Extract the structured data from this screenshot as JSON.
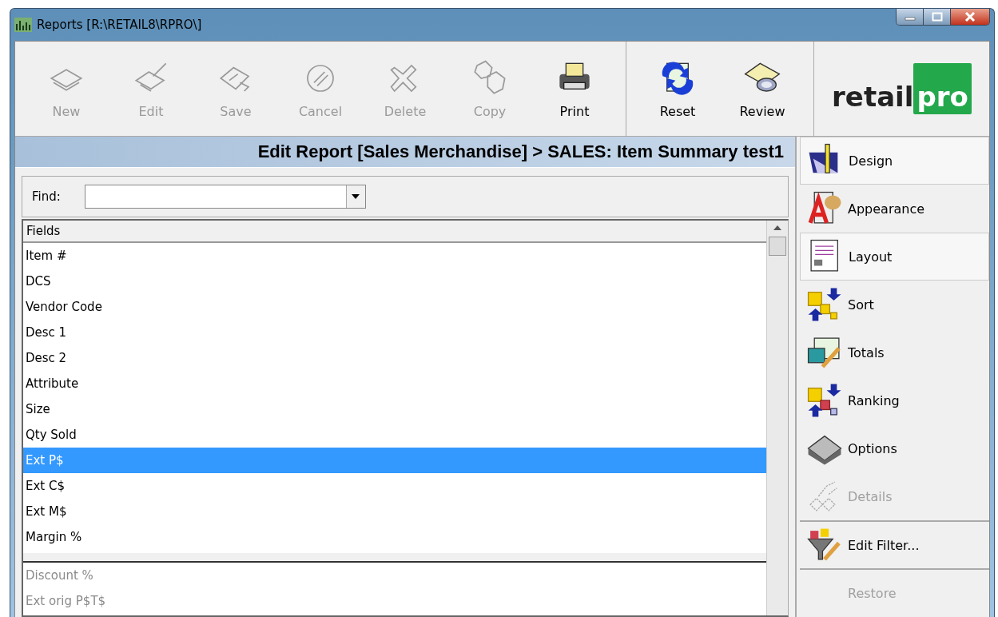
{
  "window": {
    "title": "Reports [R:\\RETAIL8\\RPRO\\]"
  },
  "toolbar": {
    "groups": [
      [
        {
          "label": "New",
          "disabled": true
        },
        {
          "label": "Edit",
          "disabled": true
        },
        {
          "label": "Save",
          "disabled": true
        },
        {
          "label": "Cancel",
          "disabled": true
        },
        {
          "label": "Delete",
          "disabled": true
        },
        {
          "label": "Copy",
          "disabled": true
        },
        {
          "label": "Print",
          "disabled": false
        }
      ],
      [
        {
          "label": "Reset",
          "disabled": false
        },
        {
          "label": "Review",
          "disabled": false
        }
      ]
    ]
  },
  "logo": {
    "text_left": "retail",
    "text_right": "pro"
  },
  "heading": "Edit Report [Sales Merchandise] > SALES: Item Summary test1",
  "find": {
    "label": "Find:"
  },
  "fields": {
    "header": "Fields",
    "items": [
      {
        "label": "Item #",
        "selected": false
      },
      {
        "label": "DCS",
        "selected": false
      },
      {
        "label": "Vendor Code",
        "selected": false
      },
      {
        "label": "Desc 1",
        "selected": false
      },
      {
        "label": "Desc 2",
        "selected": false
      },
      {
        "label": "Attribute",
        "selected": false
      },
      {
        "label": "Size",
        "selected": false
      },
      {
        "label": "Qty Sold",
        "selected": false
      },
      {
        "label": "Ext P$",
        "selected": true
      },
      {
        "label": "Ext C$",
        "selected": false
      },
      {
        "label": "Ext M$",
        "selected": false
      },
      {
        "label": "Margin %",
        "selected": false
      }
    ]
  },
  "available_fields": [
    {
      "label": "Discount %",
      "disabled": true
    },
    {
      "label": "Ext orig P$T$",
      "disabled": true
    }
  ],
  "sidebar": {
    "items": [
      {
        "label": "Design",
        "kind": "header",
        "disabled": false
      },
      {
        "label": "Appearance",
        "kind": "item",
        "disabled": false
      },
      {
        "label": "Layout",
        "kind": "header",
        "disabled": false
      },
      {
        "label": "Sort",
        "kind": "item",
        "disabled": false
      },
      {
        "label": "Totals",
        "kind": "item",
        "disabled": false
      },
      {
        "label": "Ranking",
        "kind": "item",
        "disabled": false
      },
      {
        "label": "Options",
        "kind": "item",
        "disabled": false
      },
      {
        "label": "Details",
        "kind": "item",
        "disabled": true
      },
      {
        "label": "Edit Filter...",
        "kind": "action",
        "disabled": false
      },
      {
        "label": "Restore",
        "kind": "action",
        "disabled": true
      }
    ]
  }
}
